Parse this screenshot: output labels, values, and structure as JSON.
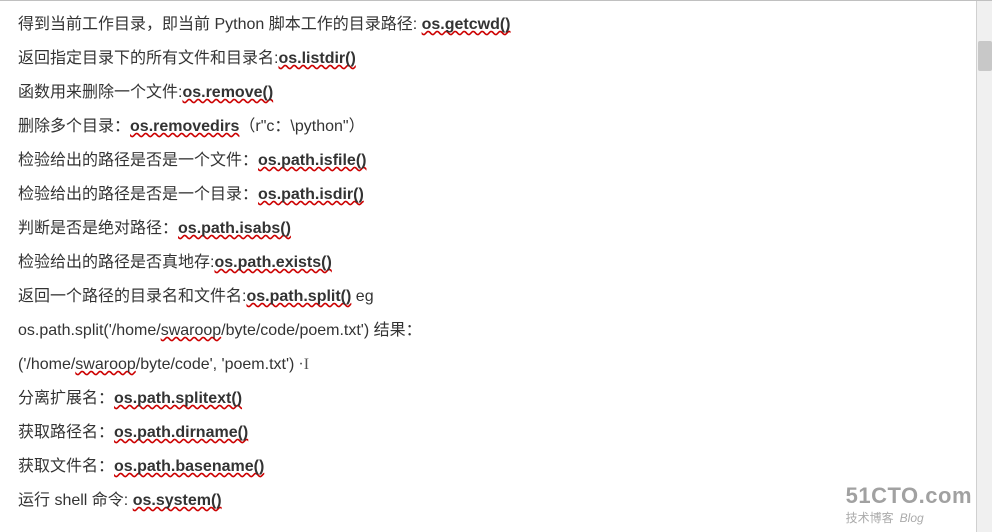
{
  "lines": [
    {
      "pre": "得到当前工作目录，即当前 Python 脚本工作的目录路径: ",
      "bold": "os.getcwd()",
      "wavy": true,
      "post": ""
    },
    {
      "pre": "返回指定目录下的所有文件和目录名:",
      "bold": "os.listdir()",
      "wavy": true,
      "post": ""
    },
    {
      "pre": "函数用来删除一个文件:",
      "bold": "os.remove()",
      "wavy": true,
      "post": ""
    },
    {
      "pre": "删除多个目录：",
      "bold": "os.removedirs",
      "wavy": true,
      "post": "（r\"c：\\python\"）"
    },
    {
      "pre": "检验给出的路径是否是一个文件：",
      "bold": "os.path.isfile()",
      "wavy": true,
      "post": ""
    },
    {
      "pre": "检验给出的路径是否是一个目录：",
      "bold": "os.path.isdir()",
      "wavy": true,
      "post": ""
    },
    {
      "pre": "判断是否是绝对路径：",
      "bold": "os.path.isabs()",
      "wavy": true,
      "post": ""
    },
    {
      "pre": "检验给出的路径是否真地存:",
      "bold": "os.path.exists()",
      "wavy": true,
      "post": ""
    },
    {
      "pre": "返回一个路径的目录名和文件名:",
      "bold": "os.path.split()",
      "wavy": true,
      "post": "     eg"
    }
  ],
  "example1": {
    "pre": "os.path.split('/home/",
    "wavy": "swaroop",
    "post": "/byte/code/poem.txt') 结果："
  },
  "example2": {
    "pre": "('/home/",
    "wavy": "swaroop",
    "post": "/byte/code', 'poem.txt')",
    "cursor": " ·I"
  },
  "lines2": [
    {
      "pre": "分离扩展名：",
      "bold": "os.path.splitext()",
      "wavy": true,
      "post": ""
    },
    {
      "pre": "获取路径名：",
      "bold": "os.path.dirname()",
      "wavy": true,
      "post": ""
    },
    {
      "pre": "获取文件名：",
      "bold": "os.path.basename()",
      "wavy": true,
      "post": ""
    },
    {
      "pre": "运行 shell 命令: ",
      "bold": "os.system()",
      "wavy": true,
      "post": ""
    }
  ],
  "watermark": {
    "title": "51CTO.com",
    "sub": "技术博客",
    "blog": "Blog"
  }
}
